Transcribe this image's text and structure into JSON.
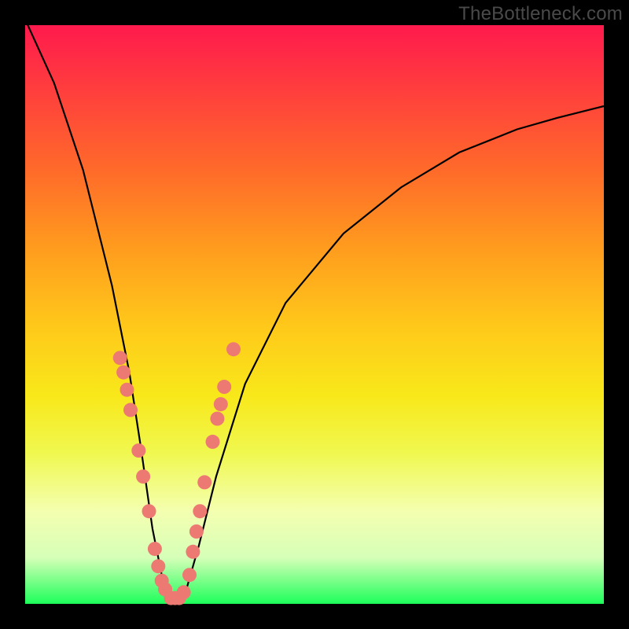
{
  "watermark": {
    "text": "TheBottleneck.com"
  },
  "chart_data": {
    "type": "line",
    "title": "",
    "xlabel": "",
    "ylabel": "",
    "xlim": [
      0,
      1
    ],
    "ylim": [
      0,
      1
    ],
    "description": "Bottleneck-style V curve: steep descent from top-left to a minimum around x≈0.25, then a concave rise toward the right edge reaching about y≈0.85 at x=1. Background is a vertical gradient from red (high y / bottleneck) through orange/yellow to green (low y / balanced).",
    "series": [
      {
        "name": "bottleneck-curve",
        "x": [
          0.0,
          0.05,
          0.1,
          0.15,
          0.18,
          0.2,
          0.22,
          0.24,
          0.26,
          0.28,
          0.3,
          0.33,
          0.38,
          0.45,
          0.55,
          0.65,
          0.75,
          0.85,
          0.92,
          1.0
        ],
        "y": [
          1.01,
          0.9,
          0.75,
          0.55,
          0.4,
          0.27,
          0.13,
          0.03,
          0.01,
          0.03,
          0.1,
          0.22,
          0.38,
          0.52,
          0.64,
          0.72,
          0.78,
          0.82,
          0.84,
          0.86
        ]
      }
    ],
    "points": {
      "name": "highlighted-samples",
      "color": "#ec7a73",
      "xy": [
        [
          0.164,
          0.425
        ],
        [
          0.17,
          0.4
        ],
        [
          0.176,
          0.37
        ],
        [
          0.182,
          0.335
        ],
        [
          0.196,
          0.265
        ],
        [
          0.204,
          0.22
        ],
        [
          0.214,
          0.16
        ],
        [
          0.224,
          0.095
        ],
        [
          0.23,
          0.065
        ],
        [
          0.236,
          0.04
        ],
        [
          0.242,
          0.025
        ],
        [
          0.252,
          0.01
        ],
        [
          0.259,
          0.01
        ],
        [
          0.266,
          0.01
        ],
        [
          0.274,
          0.02
        ],
        [
          0.284,
          0.05
        ],
        [
          0.29,
          0.09
        ],
        [
          0.296,
          0.125
        ],
        [
          0.302,
          0.16
        ],
        [
          0.31,
          0.21
        ],
        [
          0.324,
          0.28
        ],
        [
          0.332,
          0.32
        ],
        [
          0.338,
          0.345
        ],
        [
          0.344,
          0.375
        ],
        [
          0.36,
          0.44
        ]
      ]
    }
  }
}
